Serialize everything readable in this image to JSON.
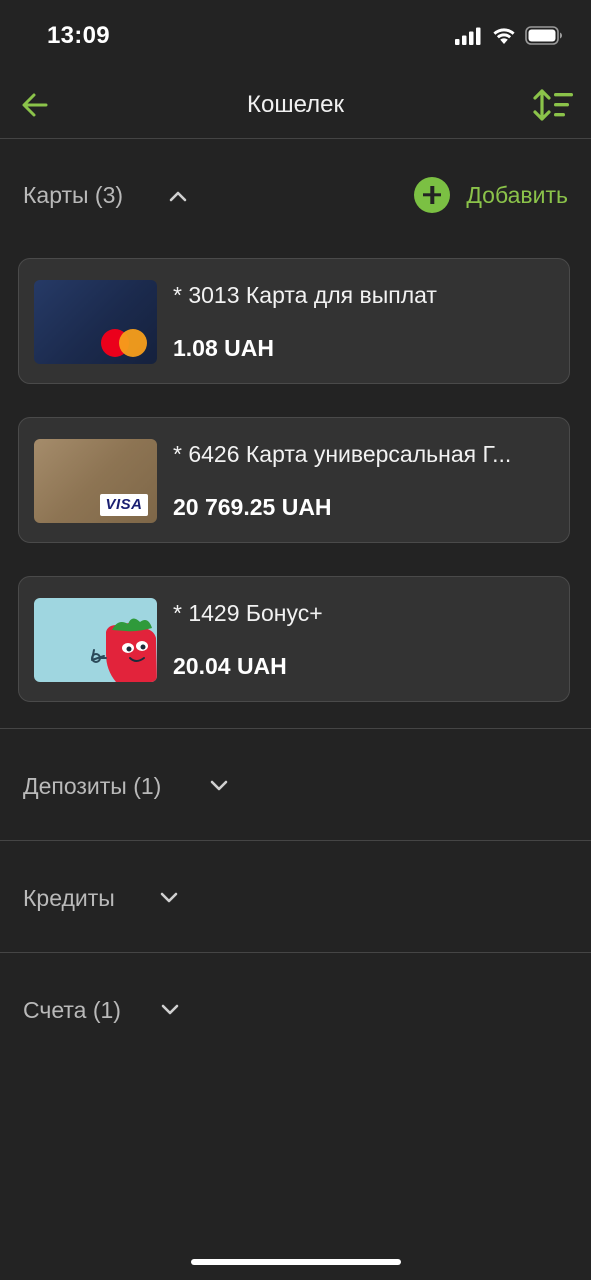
{
  "status_bar": {
    "time": "13:09"
  },
  "nav": {
    "title": "Кошелек",
    "back_icon": "arrow-left-icon",
    "sort_icon": "sort-icon"
  },
  "sections": {
    "cards": {
      "label": "Карты (3)",
      "add_label": "Добавить",
      "expanded": true
    },
    "deposits": {
      "label": "Депозиты (1)",
      "expanded": false
    },
    "credits": {
      "label": "Кредиты",
      "expanded": false
    },
    "accounts": {
      "label": "Счета (1)",
      "expanded": false
    }
  },
  "cards": [
    {
      "name": "* 3013 Карта для выплат",
      "balance": "1.08 UAH",
      "network": "mastercard"
    },
    {
      "name": "* 6426 Карта универсальная Г...",
      "balance": "20 769.25 UAH",
      "network": "visa",
      "network_label": "VISA"
    },
    {
      "name": "* 1429 Бонус+",
      "balance": "20.04 UAH",
      "network": "bonus"
    }
  ],
  "colors": {
    "accent": "#8bc34a",
    "background": "#232323",
    "card_background": "#333333"
  }
}
